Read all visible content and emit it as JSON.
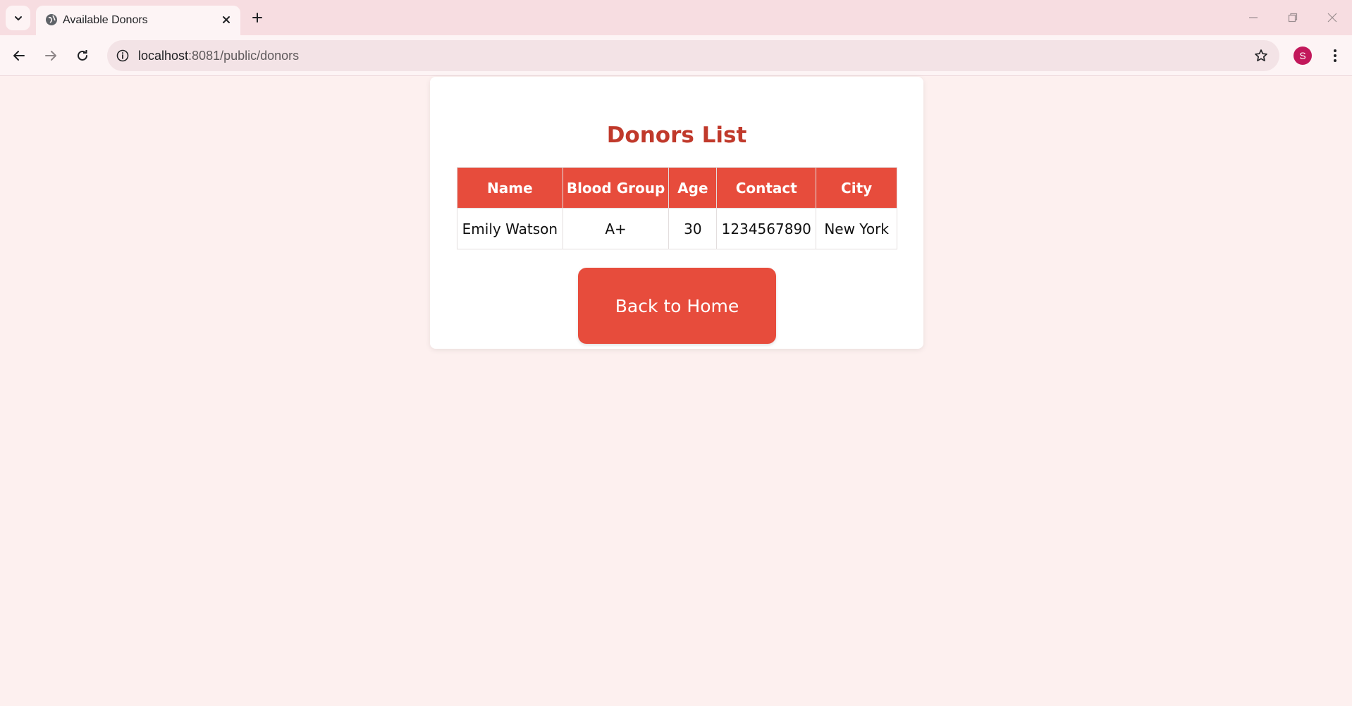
{
  "browser": {
    "tab_title": "Available Donors",
    "url_host": "localhost",
    "url_path": ":8081/public/donors",
    "profile_initial": "S",
    "profile_color": "#c2185b",
    "icons": [
      "chevron-down-icon",
      "globe-icon",
      "close-icon",
      "plus-icon",
      "minimize-icon",
      "restore-icon",
      "window-close-icon",
      "back-arrow-icon",
      "forward-arrow-icon",
      "reload-icon",
      "info-icon",
      "star-icon",
      "kebab-menu-icon"
    ]
  },
  "page": {
    "title": "Donors List",
    "accent_color": "#e74c3c",
    "title_color": "#c0392b",
    "table": {
      "headers": [
        "Name",
        "Blood Group",
        "Age",
        "Contact",
        "City"
      ],
      "rows": [
        [
          "Emily Watson",
          "A+",
          "30",
          "1234567890",
          "New York"
        ]
      ]
    },
    "back_button_label": "Back to Home"
  }
}
